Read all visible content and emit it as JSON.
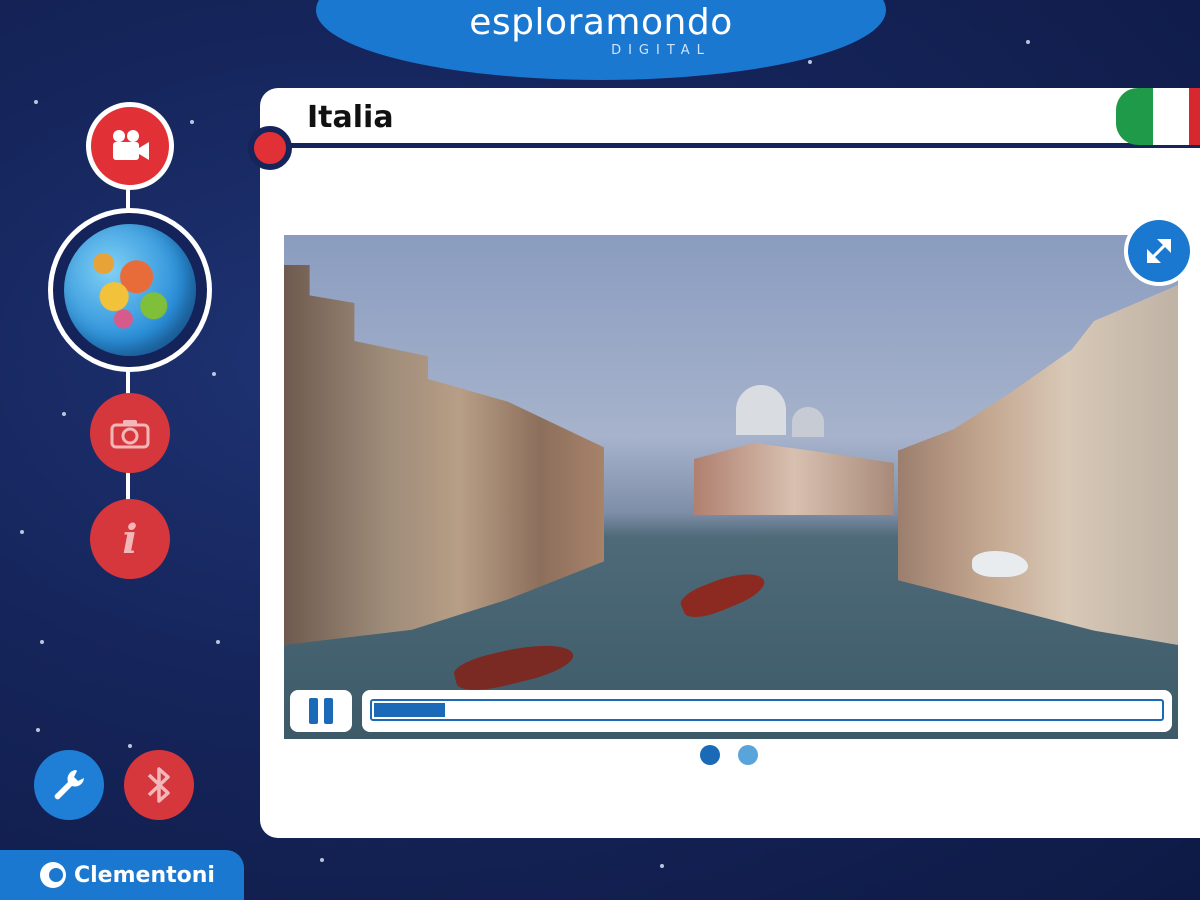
{
  "logo": {
    "main": "esploramondo",
    "sub": "DIGITAL"
  },
  "card": {
    "title": "Italia"
  },
  "flag": {
    "colors": [
      "#1f9a48",
      "#ffffff",
      "#d7282f"
    ]
  },
  "nav": {
    "items": [
      {
        "name": "video",
        "icon": "video-camera-icon",
        "active": true
      },
      {
        "name": "globe",
        "icon": "globe-icon"
      },
      {
        "name": "photo",
        "icon": "camera-icon"
      },
      {
        "name": "info",
        "icon": "info-icon",
        "label": "i"
      }
    ]
  },
  "footer_buttons": [
    {
      "name": "settings",
      "icon": "wrench-icon"
    },
    {
      "name": "bluetooth",
      "icon": "bluetooth-icon"
    }
  ],
  "brand": {
    "name": "Clementoni"
  },
  "video": {
    "scene": "venice-grand-canal",
    "playing": true,
    "progress_fraction": 0.09
  },
  "pager": {
    "total": 2,
    "current": 1
  },
  "colors": {
    "accent_blue": "#1b78d0",
    "accent_red": "#e23037",
    "background_navy": "#15245a"
  }
}
